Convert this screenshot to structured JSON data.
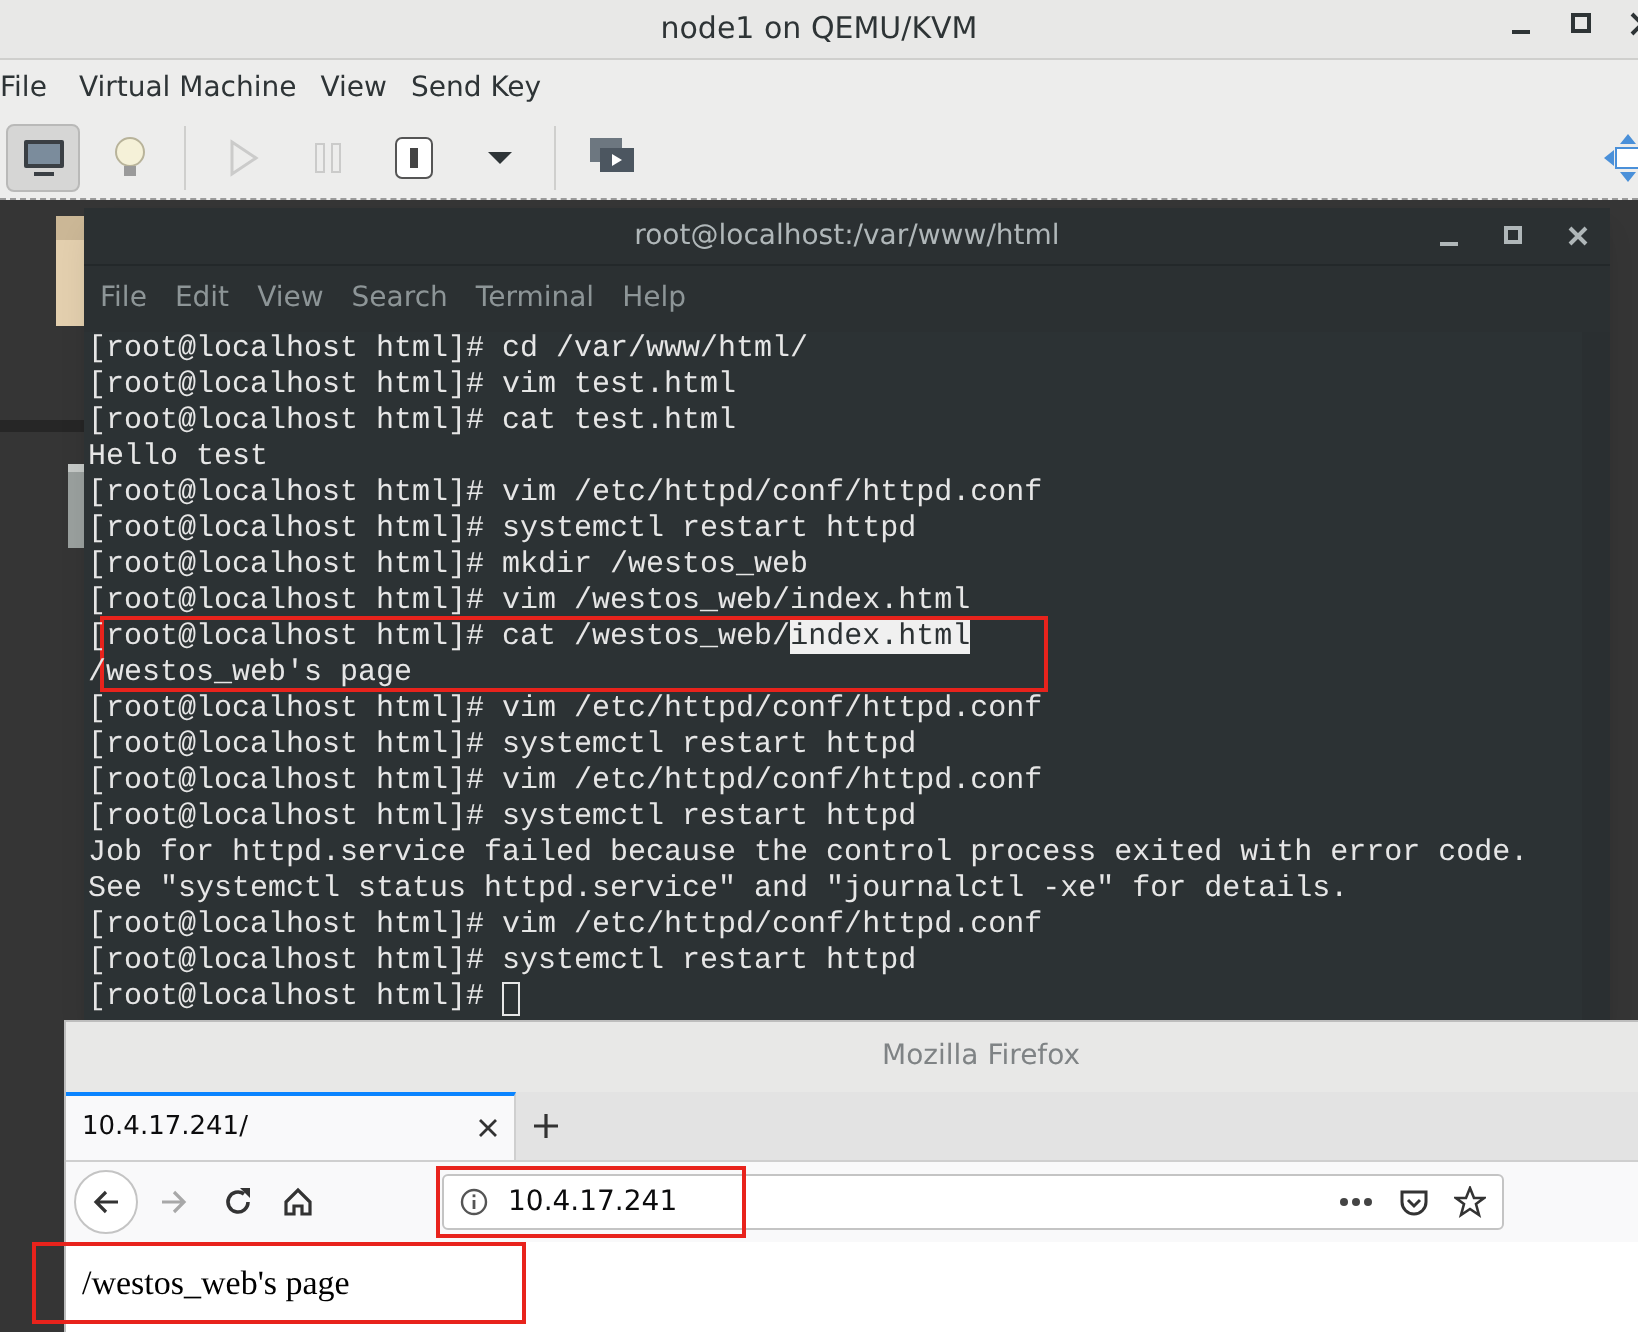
{
  "window": {
    "title": "node1 on QEMU/KVM"
  },
  "menu": [
    "File",
    "Virtual Machine",
    "View",
    "Send Key"
  ],
  "toolbar": [
    {
      "kind": "monitor",
      "selected": true,
      "disabled": false
    },
    {
      "kind": "bulb",
      "selected": false,
      "disabled": false
    },
    {
      "kind": "sep"
    },
    {
      "kind": "play",
      "selected": false,
      "disabled": true
    },
    {
      "kind": "pause",
      "selected": false,
      "disabled": true
    },
    {
      "kind": "power",
      "selected": false,
      "disabled": false
    },
    {
      "kind": "caret",
      "selected": false,
      "disabled": false
    },
    {
      "kind": "sep"
    },
    {
      "kind": "screens",
      "selected": false,
      "disabled": false
    }
  ],
  "terminal": {
    "title": "root@localhost:/var/www/html",
    "menu": [
      "File",
      "Edit",
      "View",
      "Search",
      "Terminal",
      "Help"
    ],
    "lines": [
      {
        "kind": "line",
        "segments": [
          {
            "text": "[root@localhost html]# cd /var/www/html/",
            "selected": false
          }
        ]
      },
      {
        "kind": "line",
        "segments": [
          {
            "text": "[root@localhost html]# vim test.html",
            "selected": false
          }
        ]
      },
      {
        "kind": "line",
        "segments": [
          {
            "text": "[root@localhost html]# cat test.html",
            "selected": false
          }
        ]
      },
      {
        "kind": "line",
        "segments": [
          {
            "text": "Hello test",
            "selected": false
          }
        ]
      },
      {
        "kind": "line",
        "segments": [
          {
            "text": "[root@localhost html]# vim /etc/httpd/conf/httpd.conf",
            "selected": false
          }
        ]
      },
      {
        "kind": "line",
        "segments": [
          {
            "text": "[root@localhost html]# systemctl restart httpd",
            "selected": false
          }
        ]
      },
      {
        "kind": "line",
        "segments": [
          {
            "text": "[root@localhost html]# mkdir /westos_web",
            "selected": false
          }
        ]
      },
      {
        "kind": "line",
        "segments": [
          {
            "text": "[root@localhost html]# vim /westos_web/index.html",
            "selected": false
          }
        ]
      },
      {
        "kind": "annotation",
        "lines": [
          {
            "kind": "line",
            "segments": [
              {
                "text": "[root@localhost html]# cat /westos_web/",
                "selected": false
              },
              {
                "text": "index.html",
                "selected": true
              }
            ]
          },
          {
            "kind": "line",
            "segments": [
              {
                "text": "/westos_web's page",
                "selected": false
              }
            ]
          }
        ]
      },
      {
        "kind": "line",
        "segments": [
          {
            "text": "[root@localhost html]# vim /etc/httpd/conf/httpd.conf",
            "selected": false
          }
        ]
      },
      {
        "kind": "line",
        "segments": [
          {
            "text": "[root@localhost html]# systemctl restart httpd",
            "selected": false
          }
        ]
      },
      {
        "kind": "line",
        "segments": [
          {
            "text": "[root@localhost html]# vim /etc/httpd/conf/httpd.conf",
            "selected": false
          }
        ]
      },
      {
        "kind": "line",
        "segments": [
          {
            "text": "[root@localhost html]# systemctl restart httpd",
            "selected": false
          }
        ]
      },
      {
        "kind": "line",
        "segments": [
          {
            "text": "Job for httpd.service failed because the control process exited with error code.",
            "selected": false
          }
        ]
      },
      {
        "kind": "line",
        "segments": [
          {
            "text": "See \"systemctl status httpd.service\" and \"journalctl -xe\" for details.",
            "selected": false
          }
        ]
      },
      {
        "kind": "line",
        "segments": [
          {
            "text": "[root@localhost html]# vim /etc/httpd/conf/httpd.conf",
            "selected": false
          }
        ]
      },
      {
        "kind": "line",
        "segments": [
          {
            "text": "[root@localhost html]# systemctl restart httpd",
            "selected": false
          }
        ]
      },
      {
        "kind": "line",
        "cursor": true,
        "segments": [
          {
            "text": "[root@localhost html]# ",
            "selected": false
          }
        ]
      }
    ]
  },
  "browser": {
    "title": "Mozilla Firefox",
    "tabs": [
      {
        "label": "10.4.17.241/",
        "selected": true
      }
    ],
    "url": "10.4.17.241",
    "url_annotated": true,
    "content": "/westos_web's page",
    "content_annotated": true
  }
}
